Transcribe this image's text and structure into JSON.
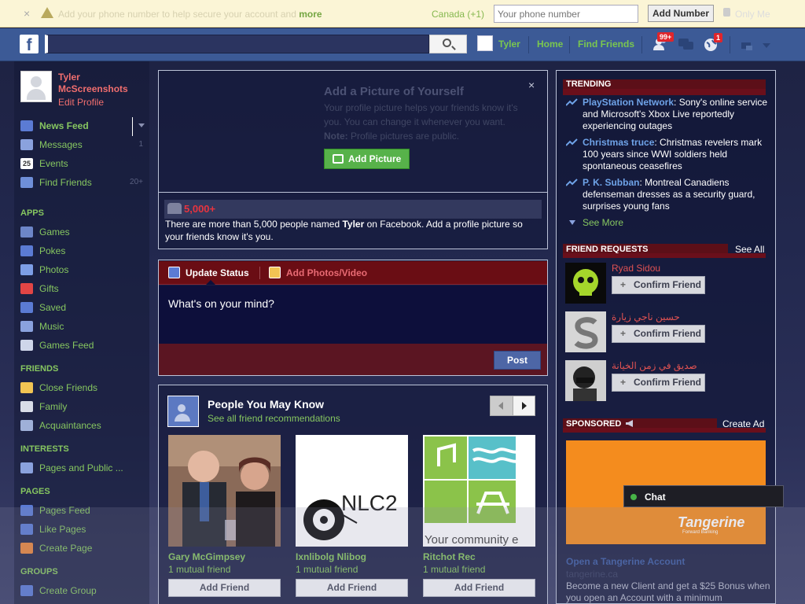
{
  "notice": {
    "close": "×",
    "message": "Add your phone number to help secure your account and ",
    "more": "more",
    "country": "Canada (+1)",
    "phone_placeholder": "Your phone number",
    "add_number": "Add Number",
    "privacy": "Only Me"
  },
  "topbar": {
    "logo": "f",
    "user": "Tyler",
    "home": "Home",
    "find_friends": "Find Friends",
    "badges": {
      "friends": "99+",
      "notifications": "1"
    }
  },
  "profile": {
    "name": "Tyler McScreenshots",
    "edit": "Edit Profile"
  },
  "nav": {
    "main": [
      {
        "label": "News Feed",
        "count": ""
      },
      {
        "label": "Messages",
        "count": "1"
      },
      {
        "label": "Events",
        "count": ""
      },
      {
        "label": "Find Friends",
        "count": "20+"
      }
    ],
    "apps_header": "APPS",
    "apps": [
      "Games",
      "Pokes",
      "Photos",
      "Gifts",
      "Saved",
      "Music",
      "Games Feed"
    ],
    "friends_header": "FRIENDS",
    "friends": [
      "Close Friends",
      "Family",
      "Acquaintances"
    ],
    "interests_header": "INTERESTS",
    "interests": [
      "Pages and Public ..."
    ],
    "pages_header": "PAGES",
    "pages": [
      "Pages Feed",
      "Like Pages",
      "Create Page"
    ],
    "groups_header": "GROUPS",
    "groups": [
      "Create Group"
    ],
    "events_icon_text": "25"
  },
  "addpic": {
    "title": "Add a Picture of Yourself",
    "desc": "Your profile picture helps your friends know it's you. You can change it whenever you want.",
    "note_label": "Note:",
    "note": " Profile pictures are public.",
    "button": "Add Picture",
    "close": "×"
  },
  "namecount": {
    "count": "5,000+",
    "text_before": "There are more than 5,000 people named ",
    "name": "Tyler",
    "text_after": " on Facebook. Add a profile picture so your friends know it's you."
  },
  "composer": {
    "tab_status": "Update Status",
    "tab_photos": "Add Photos/Video",
    "placeholder": "What's on your mind?",
    "post": "Post"
  },
  "pymk": {
    "title": "People You May Know",
    "see_all": "See all friend recommendations",
    "cards": [
      {
        "name": "Gary McGimpsey",
        "mutual": "1 mutual friend",
        "button": "Add Friend",
        "image": "photo-couple"
      },
      {
        "name": "Ixnlibolg Nlibog",
        "mutual": "1 mutual friend",
        "button": "Add Friend",
        "image": "nlc2-logo",
        "logo_text": "NLC2"
      },
      {
        "name": "Ritchot Rec",
        "mutual": "1 mutual friend",
        "button": "Add Friend",
        "image": "community-logo",
        "caption": "Your community e"
      }
    ]
  },
  "trending": {
    "header": "TRENDING",
    "items": [
      {
        "topic": "PlayStation Network",
        "text": ": Sony's online service and Microsoft's Xbox Live reportedly experiencing outages"
      },
      {
        "topic": "Christmas truce",
        "text": ": Christmas revelers mark 100 years since WWI soldiers held spontaneous ceasefires"
      },
      {
        "topic": "P. K. Subban",
        "text": ": Montreal Canadiens defenseman dresses as a security guard, surprises young fans"
      }
    ],
    "see_more": "See More"
  },
  "friend_requests": {
    "header": "FRIEND REQUESTS",
    "see_all": "See All",
    "items": [
      {
        "name": "Ryad Sidou",
        "button": "Confirm Friend"
      },
      {
        "name": "حسين ناجي زيارة",
        "button": "Confirm Friend"
      },
      {
        "name": "صديق في زمن الخيانة",
        "button": "Confirm Friend"
      }
    ]
  },
  "sponsored": {
    "header": "SPONSORED",
    "create_ad": "Create Ad",
    "brand": "Tangerine",
    "brand_tag": "Forward Banking",
    "title": "Open a Tangerine Account",
    "url": "tangerine.ca",
    "text": "Become a new Client and get a $25 Bonus when you open an Account with a minimum"
  },
  "chat": {
    "label": "Chat"
  },
  "colors": {
    "accent_green": "#86c660",
    "brand_blue": "#3c5a96",
    "alert_red": "#e0252b",
    "link_blue": "#6fa3e8"
  }
}
